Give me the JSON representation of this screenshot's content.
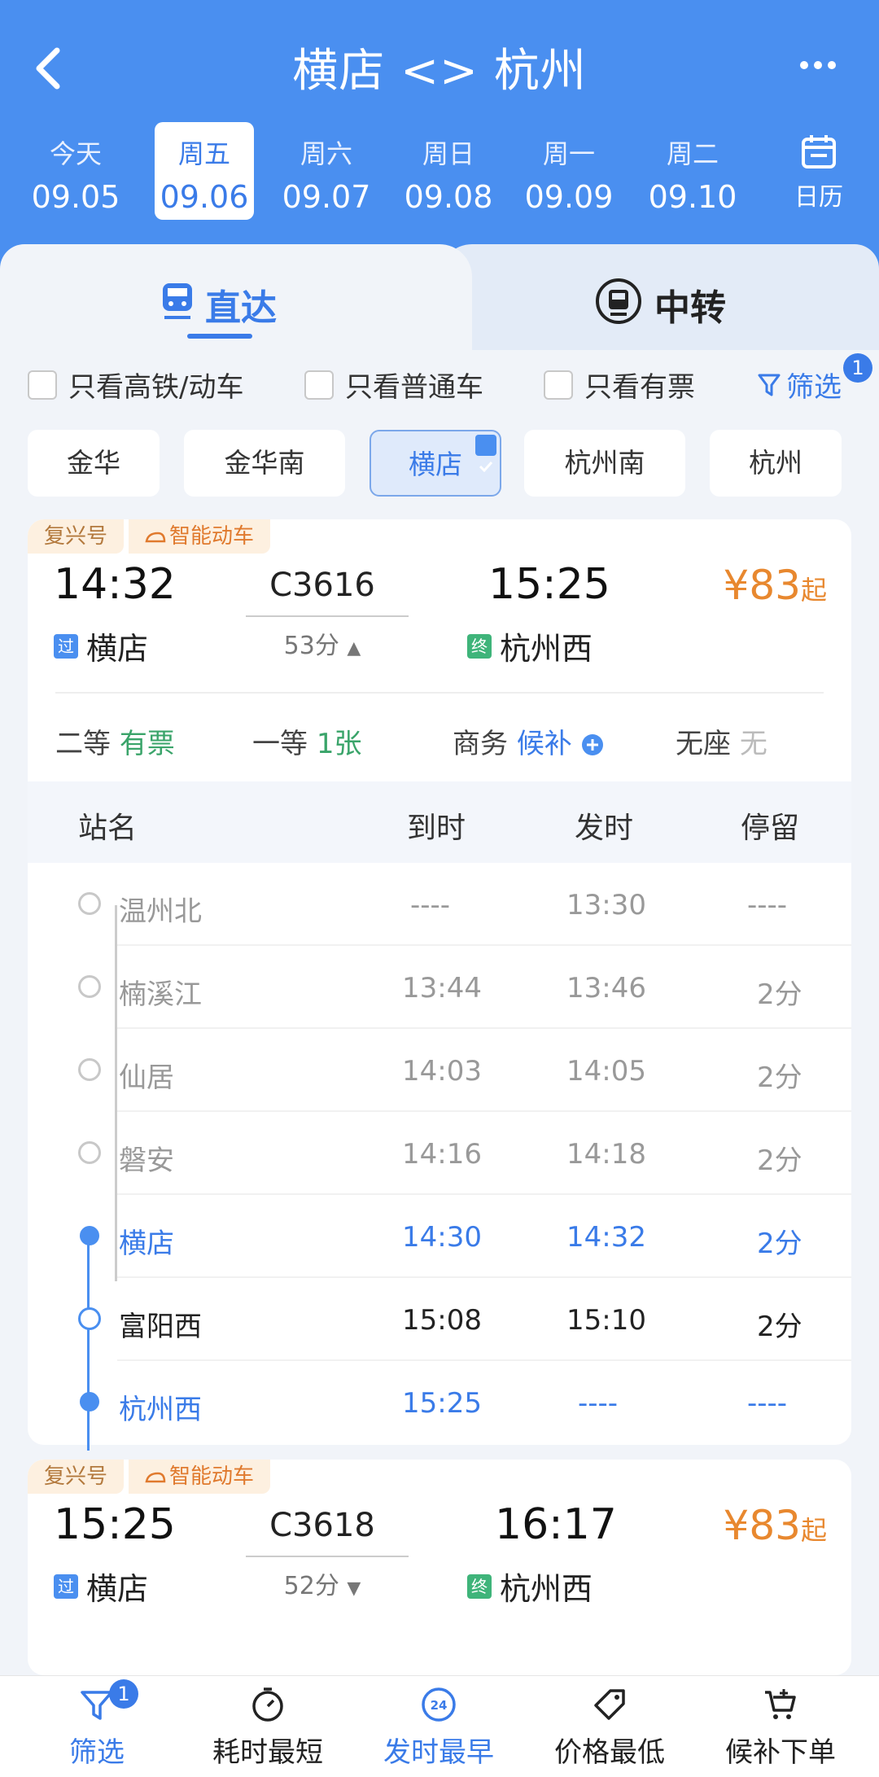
{
  "header": {
    "title": "横店 <> 杭州"
  },
  "dates": [
    {
      "weekday": "今天",
      "date": "09.05"
    },
    {
      "weekday": "周五",
      "date": "09.06",
      "active": true
    },
    {
      "weekday": "周六",
      "date": "09.07"
    },
    {
      "weekday": "周日",
      "date": "09.08"
    },
    {
      "weekday": "周一",
      "date": "09.09"
    },
    {
      "weekday": "周二",
      "date": "09.10"
    }
  ],
  "calendar_label": "日历",
  "tabs": {
    "direct": "直达",
    "transfer": "中转"
  },
  "filters": {
    "only_high_speed": "只看高铁/动车",
    "only_normal": "只看普通车",
    "only_available": "只看有票",
    "filter_label": "筛选",
    "filter_count": "1"
  },
  "stations": [
    "金华",
    "金华南",
    "横店",
    "杭州南",
    "杭州"
  ],
  "trains": [
    {
      "tags": [
        "复兴号",
        "智能动车"
      ],
      "dep_time": "14:32",
      "arr_time": "15:25",
      "train_no": "C3616",
      "duration": "53分",
      "duration_arrow": "▲",
      "price": "¥83",
      "price_suffix": "起",
      "dep_station": "横店",
      "dep_mark": "过",
      "arr_station": "杭州西",
      "arr_mark": "终",
      "seats": [
        {
          "type": "二等",
          "status": "有票"
        },
        {
          "type": "一等",
          "status": "1张"
        },
        {
          "type": "商务",
          "status": "候补"
        },
        {
          "type": "无座",
          "status": "无"
        }
      ]
    },
    {
      "tags": [
        "复兴号",
        "智能动车"
      ],
      "dep_time": "15:25",
      "arr_time": "16:17",
      "train_no": "C3618",
      "duration": "52分",
      "duration_arrow": "▼",
      "price": "¥83",
      "price_suffix": "起",
      "dep_station": "横店",
      "dep_mark": "过",
      "arr_station": "杭州西",
      "arr_mark": "终"
    }
  ],
  "stop_table": {
    "headers": {
      "name": "站名",
      "arrive": "到时",
      "depart": "发时",
      "stay": "停留"
    },
    "rows": [
      {
        "name": "温州北",
        "arrive": "----",
        "depart": "13:30",
        "stay": "----"
      },
      {
        "name": "楠溪江",
        "arrive": "13:44",
        "depart": "13:46",
        "stay": "2分"
      },
      {
        "name": "仙居",
        "arrive": "14:03",
        "depart": "14:05",
        "stay": "2分"
      },
      {
        "name": "磐安",
        "arrive": "14:16",
        "depart": "14:18",
        "stay": "2分"
      },
      {
        "name": "横店",
        "arrive": "14:30",
        "depart": "14:32",
        "stay": "2分"
      },
      {
        "name": "富阳西",
        "arrive": "15:08",
        "depart": "15:10",
        "stay": "2分"
      },
      {
        "name": "杭州西",
        "arrive": "15:25",
        "depart": "----",
        "stay": "----"
      }
    ]
  },
  "bottom_bar": {
    "filter": "筛选",
    "filter_count": "1",
    "shortest": "耗时最短",
    "earliest": "发时最早",
    "cheapest": "价格最低",
    "waitlist": "候补下单",
    "clock_24": "24"
  },
  "colors": {
    "primary": "#4a8ff0",
    "price": "#e8882f",
    "available": "#3aa46a"
  }
}
